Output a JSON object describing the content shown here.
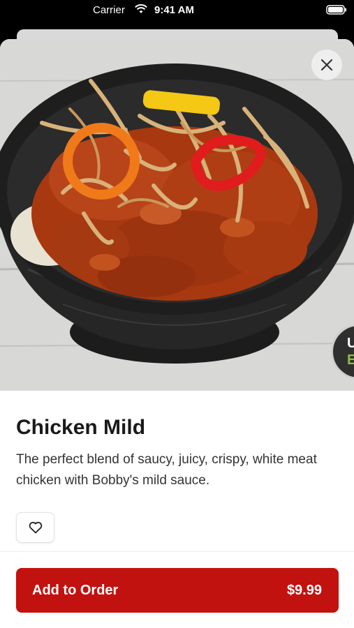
{
  "status_bar": {
    "carrier": "Carrier",
    "time": "9:41 AM",
    "icons": [
      "wifi-icon",
      "battery-icon"
    ]
  },
  "hero": {
    "image": "chicken-bowl-photo",
    "badge_line1": "U",
    "badge_line2": "E",
    "badge_line2_color": "#8fbf3a"
  },
  "close": {
    "icon": "close-icon"
  },
  "item": {
    "name": "Chicken Mild",
    "description": "The perfect blend of saucy, juicy, crispy, white meat chicken with Bobby's mild sauce."
  },
  "favorite": {
    "icon": "heart-icon"
  },
  "order": {
    "label": "Add to Order",
    "price": "$9.99",
    "color": "#c2120f"
  }
}
